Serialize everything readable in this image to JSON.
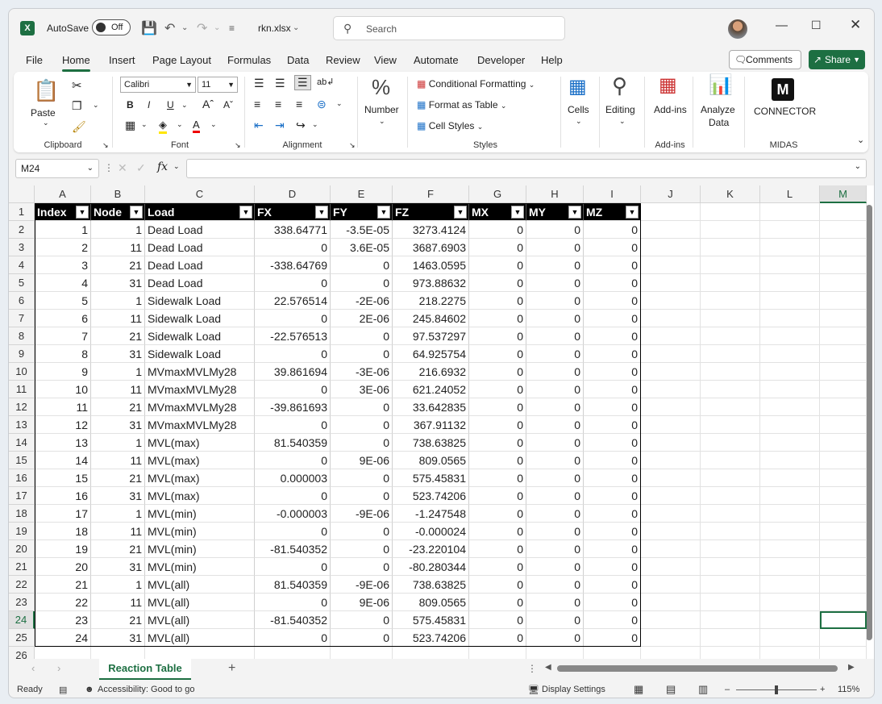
{
  "app": {
    "autosave_label": "AutoSave",
    "autosave_state": "Off",
    "filename": "rkn.xlsx",
    "search_placeholder": "Search"
  },
  "tabs": [
    "File",
    "Home",
    "Insert",
    "Page Layout",
    "Formulas",
    "Data",
    "Review",
    "View",
    "Automate",
    "Developer",
    "Help"
  ],
  "buttons": {
    "comments": "Comments",
    "share": "Share"
  },
  "ribbon": {
    "paste": "Paste",
    "clipboard": "Clipboard",
    "font_name": "Calibri",
    "font_size": "11",
    "font": "Font",
    "alignment": "Alignment",
    "number": "Number",
    "cond_format": "Conditional Formatting",
    "format_table": "Format as Table",
    "cell_styles": "Cell Styles",
    "styles": "Styles",
    "cells": "Cells",
    "editing": "Editing",
    "addins": "Add-ins",
    "addins_group": "Add-ins",
    "analyze_line1": "Analyze",
    "analyze_line2": "Data",
    "connector": "CONNECTOR",
    "midas": "MIDAS"
  },
  "namebox": "M24",
  "columns": [
    "A",
    "B",
    "C",
    "D",
    "E",
    "F",
    "G",
    "H",
    "I",
    "J",
    "K",
    "L",
    "M"
  ],
  "table": {
    "headers": [
      "Index",
      "Node",
      "Load",
      "FX",
      "FY",
      "FZ",
      "MX",
      "MY",
      "MZ"
    ],
    "rows": [
      [
        "1",
        "1",
        "Dead Load",
        "338.64771",
        "-3.5E-05",
        "3273.4124",
        "0",
        "0",
        "0"
      ],
      [
        "2",
        "11",
        "Dead Load",
        "0",
        "3.6E-05",
        "3687.6903",
        "0",
        "0",
        "0"
      ],
      [
        "3",
        "21",
        "Dead Load",
        "-338.64769",
        "0",
        "1463.0595",
        "0",
        "0",
        "0"
      ],
      [
        "4",
        "31",
        "Dead Load",
        "0",
        "0",
        "973.88632",
        "0",
        "0",
        "0"
      ],
      [
        "5",
        "1",
        "Sidewalk Load",
        "22.576514",
        "-2E-06",
        "218.2275",
        "0",
        "0",
        "0"
      ],
      [
        "6",
        "11",
        "Sidewalk Load",
        "0",
        "2E-06",
        "245.84602",
        "0",
        "0",
        "0"
      ],
      [
        "7",
        "21",
        "Sidewalk Load",
        "-22.576513",
        "0",
        "97.537297",
        "0",
        "0",
        "0"
      ],
      [
        "8",
        "31",
        "Sidewalk Load",
        "0",
        "0",
        "64.925754",
        "0",
        "0",
        "0"
      ],
      [
        "9",
        "1",
        "MVmaxMVLMy28",
        "39.861694",
        "-3E-06",
        "216.6932",
        "0",
        "0",
        "0"
      ],
      [
        "10",
        "11",
        "MVmaxMVLMy28",
        "0",
        "3E-06",
        "621.24052",
        "0",
        "0",
        "0"
      ],
      [
        "11",
        "21",
        "MVmaxMVLMy28",
        "-39.861693",
        "0",
        "33.642835",
        "0",
        "0",
        "0"
      ],
      [
        "12",
        "31",
        "MVmaxMVLMy28",
        "0",
        "0",
        "367.91132",
        "0",
        "0",
        "0"
      ],
      [
        "13",
        "1",
        "MVL(max)",
        "81.540359",
        "0",
        "738.63825",
        "0",
        "0",
        "0"
      ],
      [
        "14",
        "11",
        "MVL(max)",
        "0",
        "9E-06",
        "809.0565",
        "0",
        "0",
        "0"
      ],
      [
        "15",
        "21",
        "MVL(max)",
        "0.000003",
        "0",
        "575.45831",
        "0",
        "0",
        "0"
      ],
      [
        "16",
        "31",
        "MVL(max)",
        "0",
        "0",
        "523.74206",
        "0",
        "0",
        "0"
      ],
      [
        "17",
        "1",
        "MVL(min)",
        "-0.000003",
        "-9E-06",
        "-1.247548",
        "0",
        "0",
        "0"
      ],
      [
        "18",
        "11",
        "MVL(min)",
        "0",
        "0",
        "-0.000024",
        "0",
        "0",
        "0"
      ],
      [
        "19",
        "21",
        "MVL(min)",
        "-81.540352",
        "0",
        "-23.220104",
        "0",
        "0",
        "0"
      ],
      [
        "20",
        "31",
        "MVL(min)",
        "0",
        "0",
        "-80.280344",
        "0",
        "0",
        "0"
      ],
      [
        "21",
        "1",
        "MVL(all)",
        "81.540359",
        "-9E-06",
        "738.63825",
        "0",
        "0",
        "0"
      ],
      [
        "22",
        "11",
        "MVL(all)",
        "0",
        "9E-06",
        "809.0565",
        "0",
        "0",
        "0"
      ],
      [
        "23",
        "21",
        "MVL(all)",
        "-81.540352",
        "0",
        "575.45831",
        "0",
        "0",
        "0"
      ],
      [
        "24",
        "31",
        "MVL(all)",
        "0",
        "0",
        "523.74206",
        "0",
        "0",
        "0"
      ]
    ]
  },
  "sheet_tab": "Reaction Table",
  "status": {
    "ready": "Ready",
    "accessibility": "Accessibility: Good to go",
    "display": "Display Settings",
    "zoom": "115%"
  },
  "colors": {
    "excel_green": "#1d6f42"
  }
}
